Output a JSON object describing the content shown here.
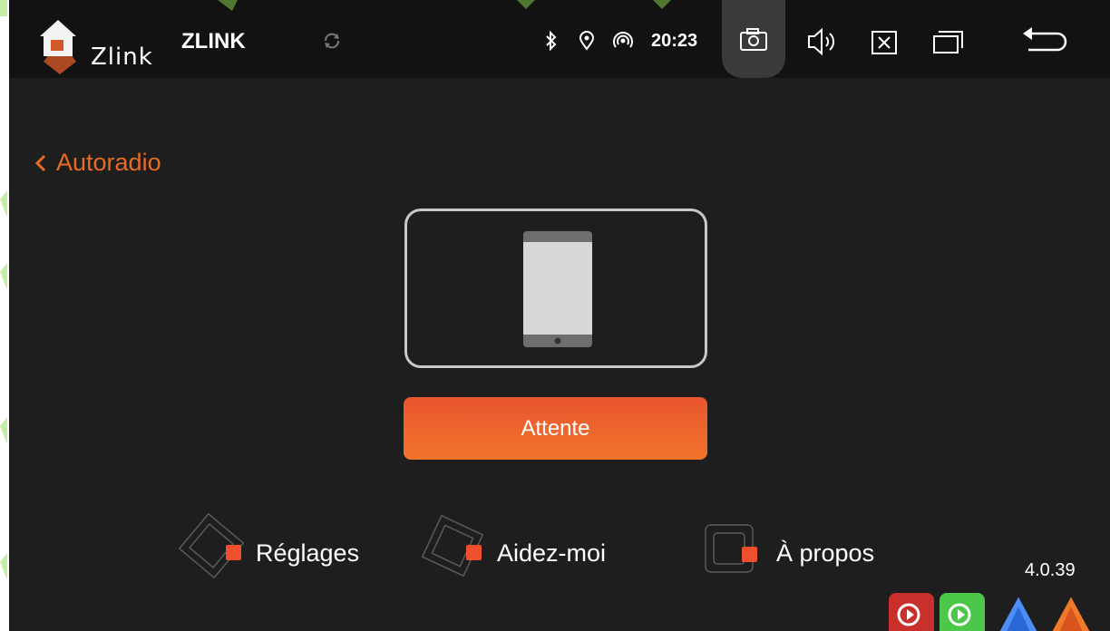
{
  "statusbar": {
    "logo_text": "Zlink",
    "app_title": "ZLINK",
    "time": "20:23",
    "icons": [
      "bluetooth-icon",
      "location-icon",
      "hotspot-icon"
    ],
    "buttons": [
      "screenshot-icon",
      "volume-icon",
      "close-app-icon",
      "recent-apps-icon",
      "back-arrow-icon"
    ]
  },
  "nav": {
    "back_label": "Autoradio"
  },
  "main": {
    "device_icon": "phone-icon",
    "wait_button_label": "Attente"
  },
  "menu": [
    {
      "label": "Réglages"
    },
    {
      "label": "Aidez-moi"
    },
    {
      "label": "À propos"
    }
  ],
  "version": "4.0.39",
  "colors": {
    "accent": "#e8552f",
    "background": "#1e1e1e",
    "statusbar": "#121212",
    "watermark": "#8ddc4c"
  },
  "bottom_apps": [
    "carplay-red-icon",
    "carplay-green-icon",
    "android-auto-blue-icon",
    "android-auto-orange-icon"
  ]
}
